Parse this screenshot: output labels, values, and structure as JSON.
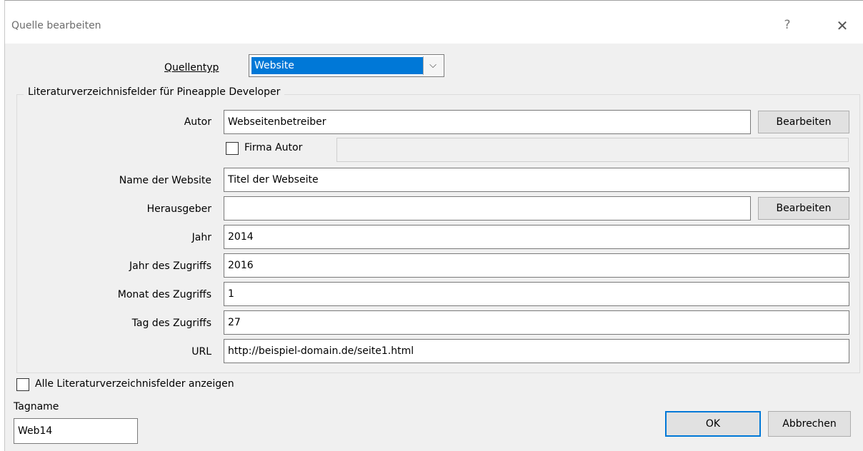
{
  "dialog": {
    "title": "Quelle bearbeiten",
    "help_glyph": "?",
    "close_glyph": "✕"
  },
  "source_type": {
    "label": "Quellentyp",
    "value": "Website",
    "arrow_glyph": "⌵"
  },
  "fields_group": {
    "title": "Literaturverzeichnisfelder für Pineapple Developer"
  },
  "author": {
    "label": "Autor",
    "value": "Webseitenbetreiber",
    "edit_button": "Bearbeiten"
  },
  "corporate_author": {
    "label": "Firma Autor",
    "checked": false,
    "value": ""
  },
  "website_name": {
    "label": "Name der Website",
    "value": "Titel der Webseite"
  },
  "publisher": {
    "label": "Herausgeber",
    "value": "",
    "edit_button": "Bearbeiten"
  },
  "year": {
    "label": "Jahr",
    "value": "2014"
  },
  "year_accessed": {
    "label": "Jahr des Zugriffs",
    "value": "2016"
  },
  "month_accessed": {
    "label": "Monat des Zugriffs",
    "value": "1"
  },
  "day_accessed": {
    "label": "Tag des Zugriffs",
    "value": "27"
  },
  "url": {
    "label": "URL",
    "value": "http://beispiel-domain.de/seite1.html"
  },
  "show_all_fields": {
    "label": "Alle Literaturverzeichnisfelder anzeigen",
    "checked": false
  },
  "tag_name": {
    "label": "Tagname",
    "value": "Web14"
  },
  "buttons": {
    "ok": "OK",
    "cancel": "Abbrechen"
  }
}
